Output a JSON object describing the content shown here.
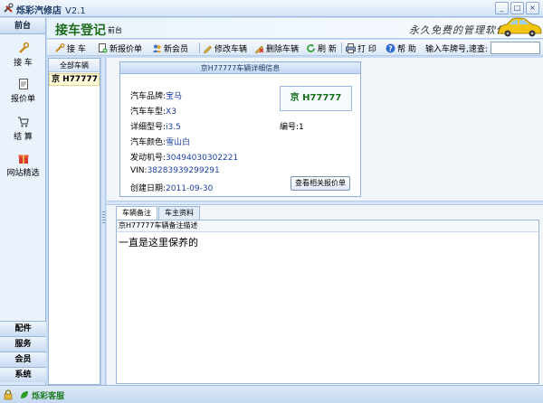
{
  "window": {
    "title": "烁彩汽修店",
    "version": "V2.1"
  },
  "sidebar": {
    "header": "前台",
    "items": [
      {
        "label": "接 车",
        "icon": "wrench-icon"
      },
      {
        "label": "报价单",
        "icon": "document-icon"
      },
      {
        "label": "结 算",
        "icon": "cart-icon"
      },
      {
        "label": "网站精选",
        "icon": "gift-icon"
      }
    ],
    "sections": [
      "配件",
      "服务",
      "会员",
      "系统"
    ]
  },
  "header": {
    "title": "接车登记",
    "subtitle": "前台",
    "slogan": "永久免费的管理软件"
  },
  "toolbar": {
    "buttons": [
      {
        "label": "接 车",
        "icon": "car-in-icon"
      },
      {
        "label": "新报价单",
        "icon": "new-quote-icon"
      },
      {
        "label": "新会员",
        "icon": "members-icon"
      },
      {
        "label": "修改车辆",
        "icon": "edit-icon"
      },
      {
        "label": "删除车辆",
        "icon": "delete-icon"
      },
      {
        "label": "刷 新",
        "icon": "refresh-icon"
      },
      {
        "label": "打 印",
        "icon": "printer-icon"
      },
      {
        "label": "帮 助",
        "icon": "help-icon"
      }
    ],
    "search_label": "输入车牌号,速查:",
    "search_value": ""
  },
  "vehicle_list": {
    "header": "全部车辆",
    "rows": [
      "京  H77777"
    ]
  },
  "detail": {
    "panel_title": "京H77777车辆详细信息",
    "plate": "京  H77777",
    "fields": [
      {
        "label": "汽车品牌:",
        "value": "宝马"
      },
      {
        "label": "汽车车型:",
        "value": "X3"
      },
      {
        "label": "详细型号:",
        "value": "i3.5"
      },
      {
        "label": "汽车颜色:",
        "value": "雪山白"
      },
      {
        "label": "发动机号:",
        "value": "30494030302221"
      },
      {
        "label": "VIN:",
        "value": "38283939299291"
      },
      {
        "label": "创建日期:",
        "value": "2011-09-30"
      }
    ],
    "serial": {
      "label": "编号:",
      "value": "1"
    },
    "quote_button": "查看相关报价单"
  },
  "tabs": {
    "items": [
      "车辆备注",
      "车主资料"
    ],
    "active": 0,
    "caption": "京H77777车辆备注描述",
    "note": "一直是这里保养的"
  },
  "status": {
    "brand": "烁彩客服"
  },
  "colors": {
    "accent": "#1c6a1c",
    "plate": "#18701c",
    "value": "#1a3fa0",
    "chrome": "#c8dcf4"
  }
}
